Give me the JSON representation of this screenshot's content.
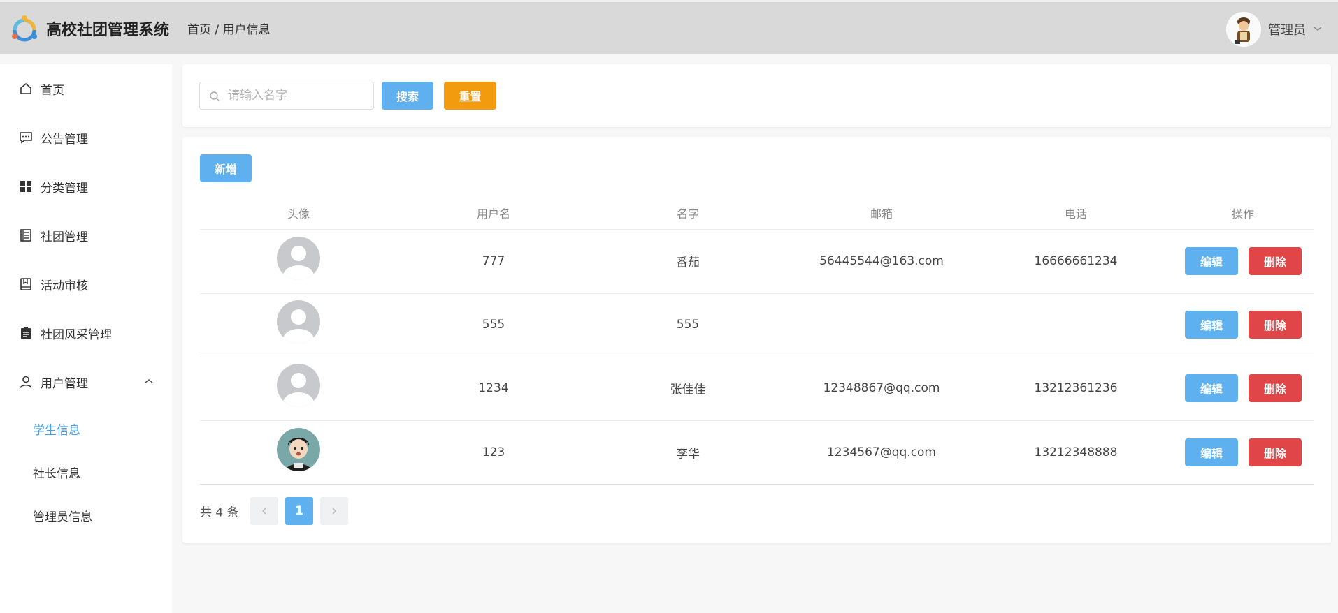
{
  "header": {
    "app_title": "高校社团管理系统",
    "breadcrumb": "首页 / 用户信息",
    "user_name": "管理员"
  },
  "sidebar": {
    "items": [
      {
        "label": "首页",
        "icon": "home-icon"
      },
      {
        "label": "公告管理",
        "icon": "message-icon"
      },
      {
        "label": "分类管理",
        "icon": "grid-icon"
      },
      {
        "label": "社团管理",
        "icon": "document-icon"
      },
      {
        "label": "活动审核",
        "icon": "notebook-icon"
      },
      {
        "label": "社团风采管理",
        "icon": "clipboard-icon"
      },
      {
        "label": "用户管理",
        "icon": "user-icon"
      }
    ],
    "sub_items": [
      {
        "label": "学生信息",
        "active": true
      },
      {
        "label": "社长信息",
        "active": false
      },
      {
        "label": "管理员信息",
        "active": false
      }
    ]
  },
  "search": {
    "placeholder": "请输入名字",
    "value": "",
    "search_label": "搜索",
    "reset_label": "重置"
  },
  "table": {
    "add_label": "新增",
    "columns": [
      "头像",
      "用户名",
      "名字",
      "邮箱",
      "电话",
      "操作"
    ],
    "rows": [
      {
        "username": "777",
        "name": "番茄",
        "email": "56445544@163.com",
        "phone": "16666661234",
        "avatar": "default"
      },
      {
        "username": "555",
        "name": "555",
        "email": "",
        "phone": "",
        "avatar": "default"
      },
      {
        "username": "1234",
        "name": "张佳佳",
        "email": "12348867@qq.com",
        "phone": "13212361236",
        "avatar": "default"
      },
      {
        "username": "123",
        "name": "李华",
        "email": "1234567@qq.com",
        "phone": "13212348888",
        "avatar": "cartoon"
      }
    ],
    "edit_label": "编辑",
    "delete_label": "删除"
  },
  "pagination": {
    "total_text": "共 4 条",
    "current_page": "1",
    "prev_icon": "chevron-left-icon",
    "next_icon": "chevron-right-icon"
  },
  "colors": {
    "primary": "#5eb1ee",
    "warning": "#f29b0e",
    "danger": "#e04547",
    "active_menu": "#4aa0e6",
    "header_bg": "#d9d9d9"
  }
}
